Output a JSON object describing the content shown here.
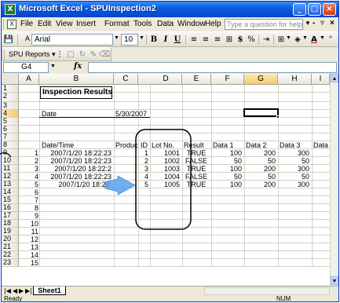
{
  "window": {
    "title": "Microsoft Excel - SPUInspection2",
    "app_icon": "X"
  },
  "menu": {
    "items": [
      "File",
      "Edit",
      "View",
      "Insert",
      "Format",
      "Tools",
      "Data",
      "Window",
      "Help"
    ],
    "help_placeholder": "Type a question for help"
  },
  "toolbar": {
    "font_name": "Arial",
    "font_size": "10",
    "bold": "B",
    "italic": "I",
    "underline": "U",
    "currency": "$",
    "percent": "%"
  },
  "toolbar2": {
    "spu_label": "SPU Reports ▾"
  },
  "formula": {
    "name_box": "G4",
    "fx": "fx",
    "value": ""
  },
  "columns": [
    "A",
    "B",
    "C",
    "D",
    "E",
    "F",
    "G",
    "H",
    "I"
  ],
  "rows": [
    "1",
    "2",
    "3",
    "4",
    "5",
    "6",
    "7",
    "8",
    "9",
    "10",
    "11",
    "12",
    "13",
    "14",
    "15",
    "16",
    "17",
    "18",
    "19",
    "20",
    "21",
    "22",
    "23"
  ],
  "sheet": {
    "title": "Inspection Results",
    "date_label": "Date",
    "date_value": "5/30/2007",
    "headers": [
      "Date/Time",
      "Product",
      "ID",
      "Lot No.",
      "Result",
      "Data 1",
      "Data 2",
      "Data 3",
      "Data 4"
    ],
    "records": [
      {
        "idx": "1",
        "datetime": "2007/1/20 18:22:23",
        "id": "1",
        "lot": "1001",
        "result": "TRUE",
        "d1": "100",
        "d2": "200",
        "d3": "300"
      },
      {
        "idx": "2",
        "datetime": "2007/1/20 18:22:23",
        "id": "2",
        "lot": "1002",
        "result": "FALSE",
        "d1": "50",
        "d2": "50",
        "d3": "50"
      },
      {
        "idx": "3",
        "datetime": "2007/1/20 18:22:2",
        "id": "3",
        "lot": "1003",
        "result": "TRUE",
        "d1": "100",
        "d2": "200",
        "d3": "300"
      },
      {
        "idx": "4",
        "datetime": "2007/1/20 18:22:23",
        "id": "4",
        "lot": "1004",
        "result": "FALSE",
        "d1": "50",
        "d2": "50",
        "d3": "50"
      },
      {
        "idx": "5",
        "datetime": "2007/1/20 18:22:",
        "id": "5",
        "lot": "1005",
        "result": "TRUE",
        "d1": "100",
        "d2": "200",
        "d3": "300"
      }
    ],
    "extra_index": [
      "6",
      "7",
      "8",
      "9",
      "10",
      "11",
      "12",
      "13",
      "14",
      "15"
    ]
  },
  "tabs": {
    "active": "Sheet1"
  },
  "status": {
    "left": "Ready",
    "right": "NUM"
  },
  "colors": {
    "title_bar": "#0a5fe0",
    "selection_header": "#f6c96a",
    "annotation_arrow": "#3a8cf3"
  }
}
